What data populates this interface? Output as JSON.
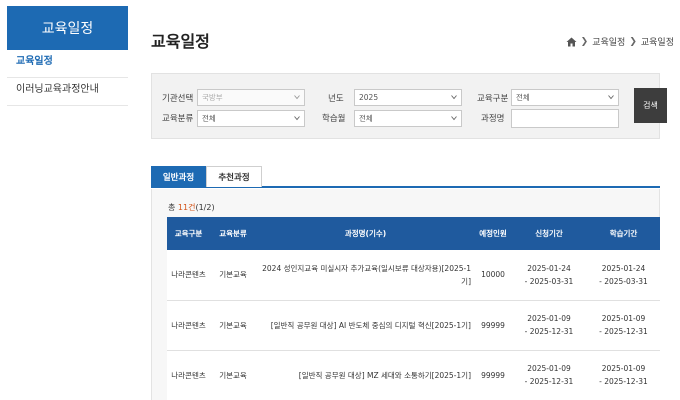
{
  "sidebar": {
    "title": "교육일정",
    "items": [
      {
        "label": "교육일정",
        "active": true
      },
      {
        "label": "이러닝교육과정안내",
        "active": false
      }
    ]
  },
  "header": {
    "title": "교육일정",
    "breadcrumb": [
      "교육일정",
      "교육일정"
    ]
  },
  "search": {
    "org_label": "기관선택",
    "org_value": "국방부",
    "year_label": "년도",
    "year_value": "2025",
    "edu_type_label": "교육구분",
    "edu_type_value": "전체",
    "category_label": "교육분류",
    "category_value": "전체",
    "month_label": "학습월",
    "month_value": "전체",
    "course_label": "과정명",
    "course_value": "",
    "button_label": "검색"
  },
  "tabs": [
    {
      "label": "일반과정",
      "active": true
    },
    {
      "label": "추천과정",
      "active": false
    }
  ],
  "results": {
    "count_prefix": "총 ",
    "count_value": "11건",
    "count_suffix": "(1/2)",
    "columns": [
      "교육구분",
      "교육분류",
      "과정명(기수)",
      "예정인원",
      "신청기간",
      "학습기간"
    ],
    "rows": [
      {
        "type": "나라콘텐츠",
        "category": "기본교육",
        "course": "2024 성인지교육 미실시자 추가교육(일시보류 대상자용)[2025-1기]",
        "capacity": "10000",
        "apply_start": "2025-01-24",
        "apply_end": "- 2025-03-31",
        "study_start": "2025-01-24",
        "study_end": "- 2025-03-31"
      },
      {
        "type": "나라콘텐츠",
        "category": "기본교육",
        "course": "[일반직 공무원 대상] AI 반도체 중심의 디지털 혁신[2025-1기]",
        "capacity": "99999",
        "apply_start": "2025-01-09",
        "apply_end": "- 2025-12-31",
        "study_start": "2025-01-09",
        "study_end": "- 2025-12-31"
      },
      {
        "type": "나라콘텐츠",
        "category": "기본교육",
        "course": "[일반직 공무원 대상] MZ 세대와 소통하기[2025-1기]",
        "capacity": "99999",
        "apply_start": "2025-01-09",
        "apply_end": "- 2025-12-31",
        "study_start": "2025-01-09",
        "study_end": "- 2025-12-31"
      }
    ]
  },
  "colors": {
    "primary": "#1d6ab3",
    "table_header": "#1f5a9e",
    "search_button": "#3d3d3d",
    "count_accent": "#d3541a"
  }
}
